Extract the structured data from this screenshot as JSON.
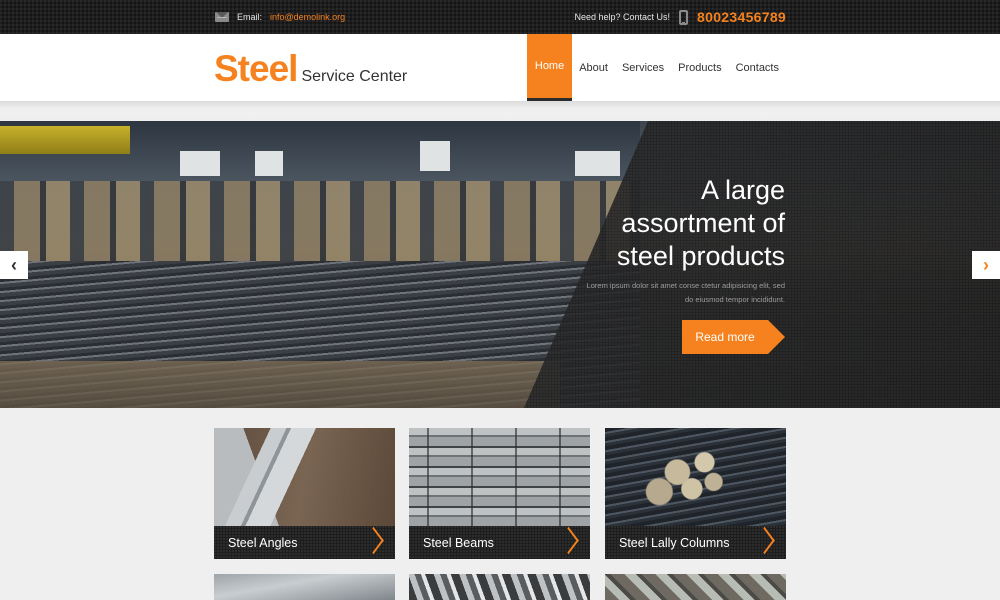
{
  "topbar": {
    "email_label": "Email:",
    "email": "info@demolink.org",
    "help_text": "Need help? Contact Us!",
    "phone": "80023456789",
    "icons": {
      "email": "envelope-icon",
      "phone": "mobile-phone-icon"
    }
  },
  "header": {
    "logo_main": "Steel",
    "logo_sub": "Service Center",
    "nav": [
      {
        "label": "Home",
        "active": true
      },
      {
        "label": "About",
        "active": false
      },
      {
        "label": "Services",
        "active": false
      },
      {
        "label": "Products",
        "active": false
      },
      {
        "label": "Contacts",
        "active": false
      }
    ]
  },
  "hero": {
    "title": "A large assortment of steel products",
    "title_lines": [
      "A large",
      "assortment of",
      "steel products"
    ],
    "description": "Lorem ipsum dolor sit amet conse ctetur adipisicing elit, sed do eiusmod tempor incididunt.",
    "button_label": "Read more",
    "prev_arrow": "‹",
    "next_arrow": "›"
  },
  "products": [
    {
      "title": "Steel Angles"
    },
    {
      "title": "Steel Beams"
    },
    {
      "title": "Steel Lally Columns"
    }
  ],
  "colors": {
    "accent": "#f5821f",
    "topbar_bg": "#1d1d1d",
    "page_bg": "#efefef"
  }
}
